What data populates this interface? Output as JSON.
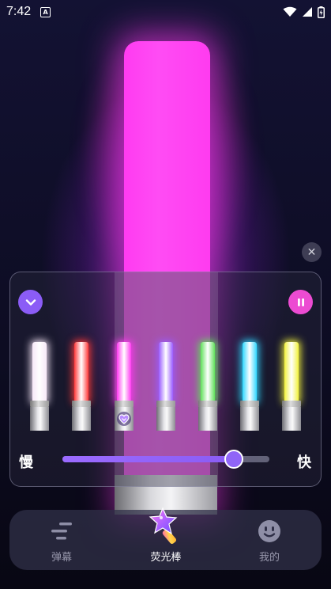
{
  "status_bar": {
    "time": "7:42",
    "notification_icon": "A"
  },
  "glowstick": {
    "current_color": "#ff3bf1"
  },
  "panel": {
    "collapse_icon": "chevron-down-icon",
    "pause_icon": "pause-icon",
    "sticks": [
      {
        "name": "white",
        "color": "#f7e8f8"
      },
      {
        "name": "red",
        "color": "#ff3a3a"
      },
      {
        "name": "magenta",
        "color": "#ff3bf1",
        "selected": true
      },
      {
        "name": "purple",
        "color": "#9a5cff"
      },
      {
        "name": "green",
        "color": "#5fe05a"
      },
      {
        "name": "cyan",
        "color": "#2fd8ff"
      },
      {
        "name": "yellow",
        "color": "#f2f23c"
      }
    ],
    "speed": {
      "slow_label": "慢",
      "fast_label": "快",
      "value": 0.83
    }
  },
  "nav": {
    "items": [
      {
        "label": "弹幕",
        "icon": "danmaku-icon",
        "active": false
      },
      {
        "label": "荧光棒",
        "icon": "glowstick-icon",
        "active": true
      },
      {
        "label": "我的",
        "icon": "smiley-icon",
        "active": false
      }
    ]
  },
  "colors": {
    "accent_purple": "#8b5cf6",
    "accent_pink": "#ec4bd2"
  }
}
